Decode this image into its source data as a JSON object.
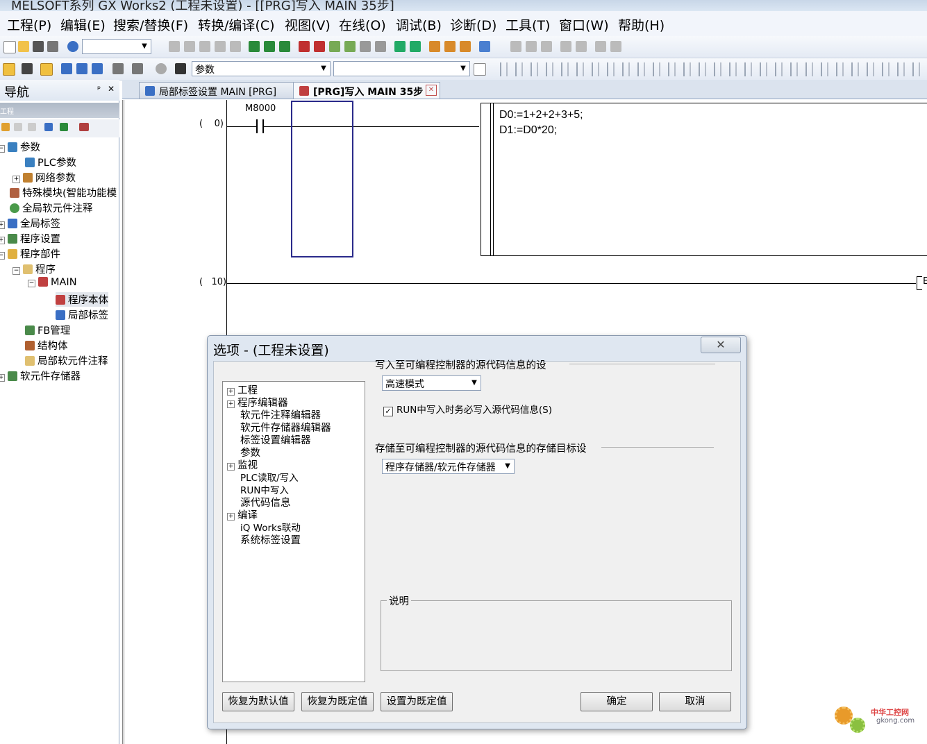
{
  "window": {
    "title": "MELSOFT系列 GX Works2 (工程未设置) - [[PRG]写入 MAIN 35步]"
  },
  "menu": [
    "工程(P)",
    "编辑(E)",
    "搜索/替换(F)",
    "转换/编译(C)",
    "视图(V)",
    "在线(O)",
    "调试(B)",
    "诊断(D)",
    "工具(T)",
    "窗口(W)",
    "帮助(H)"
  ],
  "toolbar": {
    "combo2_value": "参数"
  },
  "nav": {
    "title": "导航",
    "pin": "ᵖ",
    "close": "✕",
    "section": "工程",
    "items": [
      "参数",
      "PLC参数",
      "网络参数",
      "特殊模块(智能功能模",
      "全局软元件注释",
      "全局标签",
      "程序设置",
      "程序部件",
      "程序",
      "MAIN",
      "程序本体",
      "局部标签",
      "FB管理",
      "结构体",
      "局部软元件注释",
      "软元件存储器"
    ]
  },
  "tabs": [
    {
      "label": "局部标签设置 MAIN [PRG]"
    },
    {
      "label": "[PRG]写入 MAIN 35步",
      "close": "✕"
    }
  ],
  "ladder": {
    "step0": "(    0)",
    "step10": "(   10)",
    "contact": "M8000",
    "code_line1": "D0:=1+2+2+3+5;",
    "code_line2": "D1:=D0*20;",
    "end_fragment": "E"
  },
  "dialog": {
    "title": "选项 - (工程未设置)",
    "close": "✕",
    "tree": [
      "工程",
      "程序编辑器",
      "软元件注释编辑器",
      "软元件存储器编辑器",
      "标签设置编辑器",
      "参数",
      "监视",
      "PLC读取/写入",
      "RUN中写入",
      "源代码信息",
      "编译",
      "iQ Works联动",
      "系统标签设置"
    ],
    "group1_label": "写入至可编程控制器的源代码信息的设",
    "mode_value": "高速模式",
    "checkbox_label": "RUN中写入时务必写入源代码信息(S)",
    "checkbox_checked": true,
    "group2_label": "存储至可编程控制器的源代码信息的存储目标设",
    "target_value": "程序存储器/软元件存储器",
    "desc_label": "说明",
    "buttons": {
      "restore_default": "恢复为默认值",
      "restore_preset": "恢复为既定值",
      "set_preset": "设置为既定值",
      "ok": "确定",
      "cancel": "取消"
    }
  },
  "watermark": {
    "text1": "中华工控网",
    "text2": "gkong.com"
  }
}
